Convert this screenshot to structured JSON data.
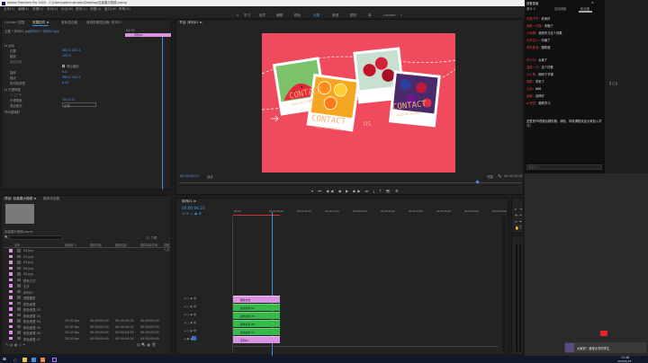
{
  "titlebar": {
    "title": "Adobe Premiere Pro 2020 - C:\\Users\\Administrator\\Desktop\\包装展示视频.prproj",
    "controls": [
      "—",
      "□",
      "✕"
    ]
  },
  "menubar": {
    "items": [
      "文件(F)",
      "编辑(E)",
      "剪辑(C)",
      "序列(S)",
      "标记(M)",
      "图形(G)",
      "视图(V)",
      "窗口(W)",
      "帮助(H)"
    ]
  },
  "workspaces": [
    "学习",
    "组件",
    "编辑",
    "颜色",
    "效果",
    "音频",
    "图形",
    "库",
    "Lumetri"
  ],
  "active_workspace": "效果",
  "source_panel": {
    "tabs": [
      "Lumetri 范围",
      "效果控件 ≡",
      "音轨混合器",
      "音频剪辑混合器: 序列01"
    ],
    "source_line": "主要 * 序列01.jpg",
    "clip_ref": "序列01 * 序列01.jpg",
    "timecode": "00:00",
    "properties": [
      {
        "name": "fx 运动",
        "value": ""
      },
      {
        "name": "位置",
        "value": "360.0  202.5"
      },
      {
        "name": "缩放",
        "value": "100.0"
      },
      {
        "name": "缩放宽度",
        "value": ""
      },
      {
        "name": "等比缩放",
        "value": "✓"
      },
      {
        "name": "旋转",
        "value": "0.0"
      },
      {
        "name": "锚点",
        "value": "360.0  202.5"
      },
      {
        "name": "防闪烁滤镜",
        "value": "0.00"
      },
      {
        "name": "fx 不透明度",
        "value": ""
      },
      {
        "name": "不透明度",
        "value": "100.0 %"
      },
      {
        "name": "混合模式",
        "value": "正常"
      },
      {
        "name": "时间重映射",
        "value": ""
      }
    ],
    "mini_clip_label": "序列01"
  },
  "program_panel": {
    "tab": "节目: 序列01 ≡",
    "timecode": "00:00:04:23",
    "fit": "适合",
    "quality": "完整",
    "duration": "00:00:10:00",
    "poster_words": [
      "CONTACT",
      "CONTACT",
      "CONTACT",
      "US"
    ],
    "poster_sub": [
      "ADD IN: 5198.8",
      "ADD IN: 5198.8",
      "ADD IN: 5198.8"
    ],
    "controls": [
      "▾",
      "⏮",
      "◀◀",
      "◀",
      "▶",
      "▶▶",
      "⏭",
      "⤓",
      "⤒",
      "📷",
      "⚙"
    ]
  },
  "project_panel": {
    "tabs": [
      "项目: 包装展示视频 ≡",
      "媒体浏览器"
    ],
    "project_file": "包装展示视频.prproj",
    "item_count": "17 个项",
    "search_placeholder": "",
    "columns": [
      "名称",
      "帧速率 ↑",
      "媒体开始",
      "媒体结束",
      "媒体持续时间",
      "视频入点"
    ],
    "rows": [
      {
        "name": "01.jpg",
        "color": "#d993e0"
      },
      {
        "name": "02.jpg",
        "color": "#d993e0"
      },
      {
        "name": "03.jpg",
        "color": "#d993e0"
      },
      {
        "name": "04.jpg",
        "color": "#d993e0"
      },
      {
        "name": "05.jpg",
        "color": "#d993e0"
      },
      {
        "name": "联系方式",
        "color": "#d993e0"
      },
      {
        "name": "文字",
        "color": "#d993e0"
      },
      {
        "name": "序列01",
        "color": "#d993e0"
      },
      {
        "name": "调整图层",
        "color": "#d993e0"
      },
      {
        "name": "颜色遮罩",
        "color": "#d993e0"
      },
      {
        "name": "颜色遮罩 02",
        "color": "#d993e0"
      },
      {
        "name": "颜色遮罩 03",
        "color": "#d993e0"
      },
      {
        "name": "颜色遮罩 04",
        "color": "#d993e0",
        "fps": "25.00 fps",
        "start": "00:00:00:00",
        "end": "00:00:04:24",
        "dur": "00:00:05:00"
      },
      {
        "name": "颜色遮罩 05",
        "color": "#d993e0",
        "fps": "25.00 fps",
        "start": "00:00:00:00",
        "end": "00:00:04:24",
        "dur": "00:00:05:00"
      },
      {
        "name": "颜色遮罩 06",
        "color": "#d993e0",
        "fps": "25.00 fps",
        "start": "00:00:00:00",
        "end": "00:00:04:24",
        "dur": "00:00:05:00"
      },
      {
        "name": "颜色遮罩 07",
        "color": "#d993e0",
        "fps": "25.00 fps",
        "start": "00:00:00:00",
        "end": "00:00:04:24",
        "dur": "00:00:05:00"
      }
    ]
  },
  "timeline": {
    "tab": "序列01 ≡",
    "timecode": "00:00:04:23",
    "ruler": [
      "00:00",
      "00:00:05:00",
      "00:00:10:00",
      "00:00:15:00",
      "00:00:20:00",
      "00:00:25:00",
      "00:00:30:00",
      "00:00:35:00",
      "00:00:40:00",
      "00:00:45:00"
    ],
    "tracks": [
      {
        "name": "V6",
        "clip": "联系方式",
        "type": "p"
      },
      {
        "name": "V5",
        "clip": "颜色遮罩 04",
        "type": "g"
      },
      {
        "name": "V4",
        "clip": "颜色遮罩 05",
        "type": "g"
      },
      {
        "name": "V3",
        "clip": "颜色遮罩 06",
        "type": "g"
      },
      {
        "name": "V2",
        "clip": "颜色遮罩 07",
        "type": "g"
      },
      {
        "name": "V1",
        "clip": "序列01",
        "type": "p"
      }
    ]
  },
  "chat": {
    "header": "观看直播",
    "tabs": [
      "观众 5",
      "互动消息",
      "粉丝团"
    ],
    "messages": [
      {
        "name": "花语下午",
        "text": "老师好"
      },
      {
        "name": "我是一只猫",
        "text": "来晚了"
      },
      {
        "name": "小刺猬",
        "text": "我想学习这个效果"
      },
      {
        "name": "乐学达人",
        "text": "听懂了"
      },
      {
        "name": "风吹麦浪",
        "text": "跟着做"
      },
      {
        "name": "学习中",
        "text": "太棒了"
      },
      {
        "name": "温柔一刀",
        "text": "这个好看"
      },
      {
        "name": "小小熊",
        "text": "期待下节课"
      },
      {
        "name": "绿萝",
        "text": "学到了"
      },
      {
        "name": "云朵",
        "text": "666"
      },
      {
        "name": "晨曦",
        "text": "讲得好"
      },
      {
        "name": "pr学员",
        "text": "跟着学习"
      }
    ],
    "notice": "这里是PR视频后期剪辑、调色、特效课程欢迎大家加入学习！",
    "input_placeholder": "说点什么..."
  },
  "overlay_caption": "大家好！我是大学的学生",
  "taskbar": {
    "time": "11:48",
    "date": "2020/5/18"
  },
  "colors": {
    "poster_bg": "#f04a5e",
    "accent": "#3d8fe0",
    "clip_green": "#38b84a",
    "clip_pink": "#d993e0"
  }
}
